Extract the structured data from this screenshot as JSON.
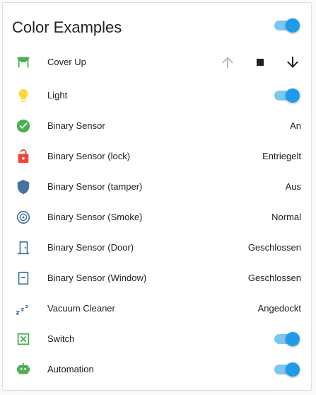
{
  "card": {
    "title": "Color Examples"
  },
  "entities": [
    {
      "name": "Cover Up",
      "icon": "cover-garage-icon",
      "color": "#4caf50",
      "controls": [
        "arrow-up-icon",
        "stop-icon",
        "arrow-down-icon"
      ]
    },
    {
      "name": "Light",
      "icon": "lightbulb-icon",
      "color": "#fdd835",
      "toggle_on": true
    },
    {
      "name": "Binary Sensor",
      "icon": "check-circle-icon",
      "color": "#4caf50",
      "state": "An"
    },
    {
      "name": "Binary Sensor (lock)",
      "icon": "lock-open-icon",
      "color": "#f44336",
      "state": "Entriegelt"
    },
    {
      "name": "Binary Sensor (tamper)",
      "icon": "shield-icon",
      "color": "#44739e",
      "state": "Aus"
    },
    {
      "name": "Binary Sensor (Smoke)",
      "icon": "smoke-detector-icon",
      "color": "#44739e",
      "state": "Normal"
    },
    {
      "name": "Binary Sensor (Door)",
      "icon": "door-closed-icon",
      "color": "#44739e",
      "state": "Geschlossen"
    },
    {
      "name": "Binary Sensor (Window)",
      "icon": "window-closed-icon",
      "color": "#44739e",
      "state": "Geschlossen"
    },
    {
      "name": "Vacuum Cleaner",
      "icon": "sleep-zzz-icon",
      "color": "#44739e",
      "state": "Angedockt"
    },
    {
      "name": "Switch",
      "icon": "switch-box-icon",
      "color": "#4caf50",
      "toggle_on": true
    },
    {
      "name": "Automation",
      "icon": "robot-icon",
      "color": "#4caf50",
      "toggle_on": true
    }
  ],
  "header_toggle_on": true,
  "colors": {
    "toggle_track": "#7cc7f0",
    "toggle_thumb": "#1e9be9",
    "disabled": "#bdbdbd"
  }
}
